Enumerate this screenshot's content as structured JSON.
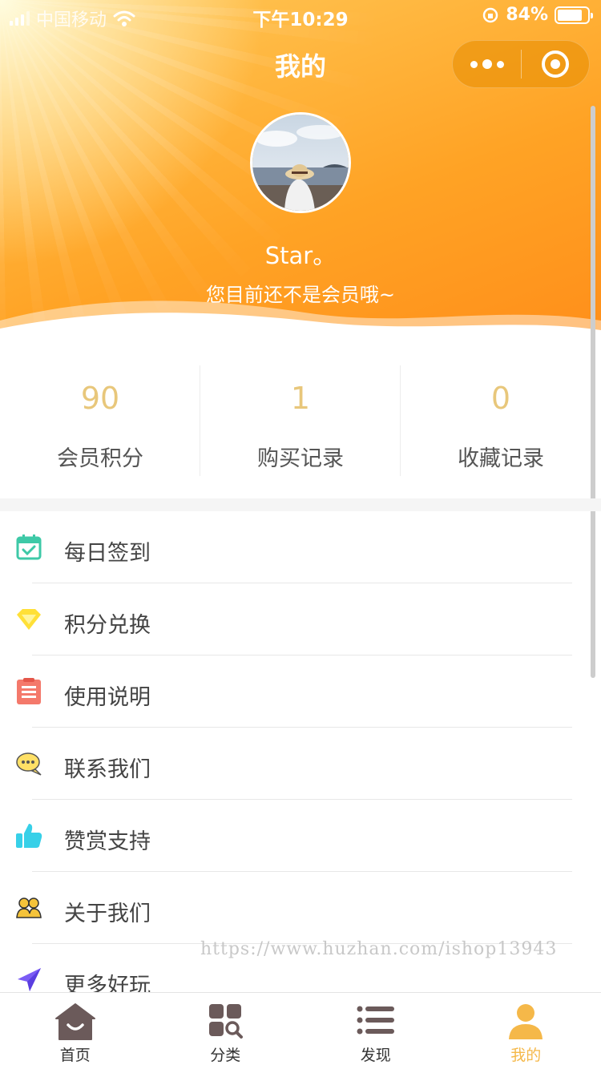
{
  "status_bar": {
    "carrier": "中国移动",
    "time": "下午10:29",
    "battery": "84%"
  },
  "nav": {
    "title": "我的"
  },
  "profile": {
    "name": "Star。",
    "subtitle": "您目前还不是会员哦~"
  },
  "stats": [
    {
      "value": "90",
      "label": "会员积分"
    },
    {
      "value": "1",
      "label": "购买记录"
    },
    {
      "value": "0",
      "label": "收藏记录"
    }
  ],
  "menu": [
    {
      "label": "每日签到",
      "icon": "calendar-check-icon",
      "color": "#3ec9a7"
    },
    {
      "label": "积分兑换",
      "icon": "diamond-icon",
      "color": "#ffe038"
    },
    {
      "label": "使用说明",
      "icon": "clipboard-icon",
      "color": "#f4796b"
    },
    {
      "label": "联系我们",
      "icon": "chat-bubble-icon",
      "color": "#ffe066"
    },
    {
      "label": "赞赏支持",
      "icon": "thumbs-up-icon",
      "color": "#37d0e8"
    },
    {
      "label": "关于我们",
      "icon": "people-icon",
      "color": "#f5c33a"
    },
    {
      "label": "更多好玩",
      "icon": "paper-plane-icon",
      "color": "#7b5cf5"
    }
  ],
  "watermark": "https://www.huzhan.com/ishop13943",
  "tabbar": [
    {
      "label": "首页",
      "icon": "home-icon",
      "active": false
    },
    {
      "label": "分类",
      "icon": "category-search-icon",
      "active": false
    },
    {
      "label": "发现",
      "icon": "list-icon",
      "active": false
    },
    {
      "label": "我的",
      "icon": "user-icon",
      "active": true
    }
  ],
  "colors": {
    "accent": "#f5b849",
    "stat_number": "#e8c77b",
    "tab_icon": "#6b5a5a",
    "header_orange": "#ffa325"
  }
}
